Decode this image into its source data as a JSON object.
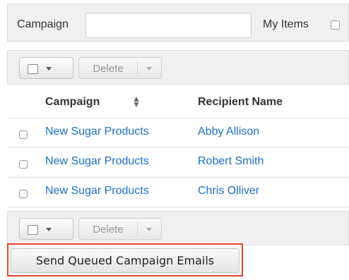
{
  "filter": {
    "campaign_label": "Campaign",
    "campaign_value": "",
    "my_items_label": "My Items"
  },
  "actions": {
    "delete_label": "Delete"
  },
  "table": {
    "headers": {
      "campaign": "Campaign",
      "recipient": "Recipient Name"
    },
    "rows": [
      {
        "campaign": "New Sugar Products",
        "recipient": "Abby Allison"
      },
      {
        "campaign": "New Sugar Products",
        "recipient": "Robert Smith"
      },
      {
        "campaign": "New Sugar Products",
        "recipient": "Chris Olliver"
      }
    ]
  },
  "send_button_label": "Send Queued Campaign Emails",
  "icons": {
    "sort": "sort-icon",
    "dropdown": "chevron-down-icon",
    "checkbox": "checkbox-icon"
  },
  "colors": {
    "link": "#1b6fc8",
    "highlight": "#e8432b"
  }
}
